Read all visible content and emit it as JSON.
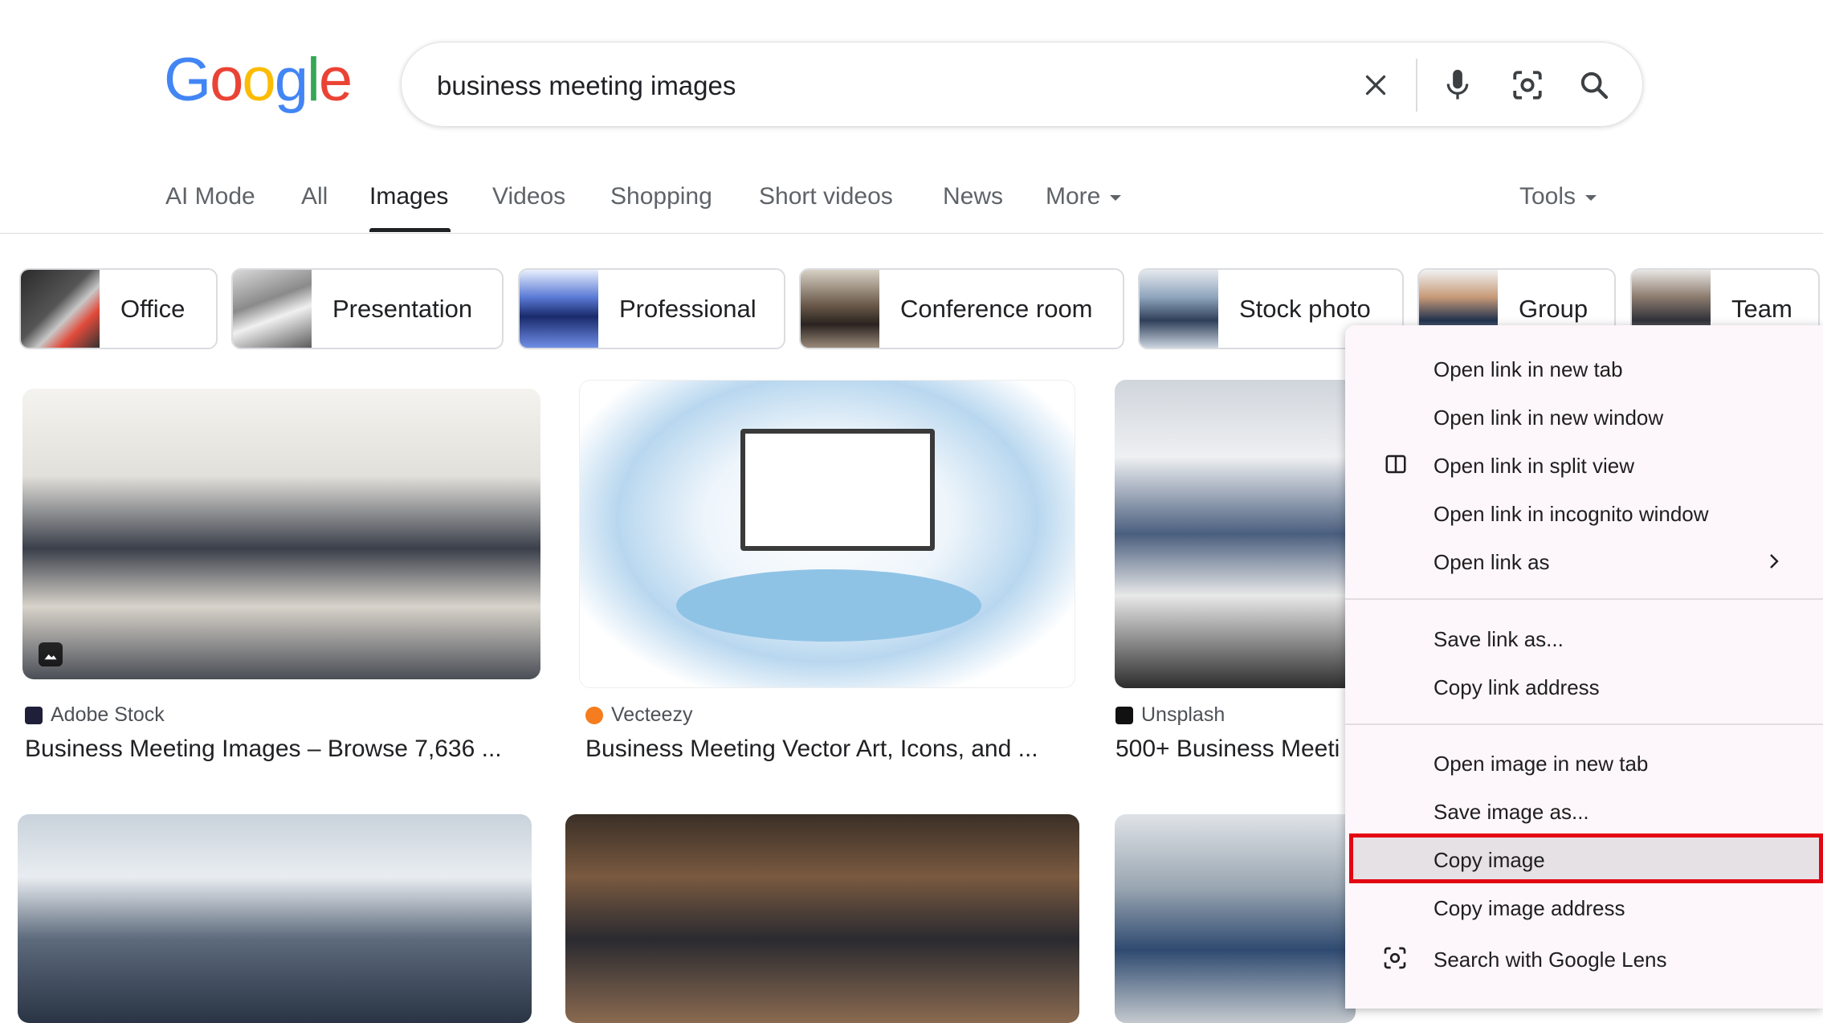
{
  "logo": {
    "letters": [
      "G",
      "o",
      "o",
      "g",
      "l",
      "e"
    ],
    "colors": [
      "#4285F4",
      "#EA4335",
      "#FBBC05",
      "#4285F4",
      "#34A853",
      "#EA4335"
    ]
  },
  "search": {
    "query": "business meeting images",
    "icons": [
      "close-icon",
      "microphone-icon",
      "camera-lens-icon",
      "search-icon"
    ]
  },
  "tabs": [
    {
      "label": "AI Mode"
    },
    {
      "label": "All"
    },
    {
      "label": "Images",
      "active": true
    },
    {
      "label": "Videos"
    },
    {
      "label": "Shopping"
    },
    {
      "label": "Short videos"
    },
    {
      "label": "News"
    },
    {
      "label": "More"
    }
  ],
  "tools_label": "Tools",
  "chips": [
    "Office",
    "Presentation",
    "Professional",
    "Conference room",
    "Stock photo",
    "Group",
    "Team"
  ],
  "results": [
    {
      "source": "Adobe Stock",
      "title": "Business Meeting Images – Browse 7,636 ..."
    },
    {
      "source": "Vecteezy",
      "title": "Business Meeting Vector Art, Icons, and ..."
    },
    {
      "source": "Unsplash",
      "title": "500+ Business Meeti"
    }
  ],
  "context_menu": {
    "group1": [
      "Open link in new tab",
      "Open link in new window",
      "Open link in split view",
      "Open link in incognito window",
      "Open link as"
    ],
    "group2": [
      "Save link as...",
      "Copy link address"
    ],
    "group3": [
      "Open image in new tab",
      "Save image as...",
      "Copy image",
      "Copy image address",
      "Search with Google Lens"
    ],
    "highlighted": "Copy image",
    "highlight_color": "#e30613"
  }
}
